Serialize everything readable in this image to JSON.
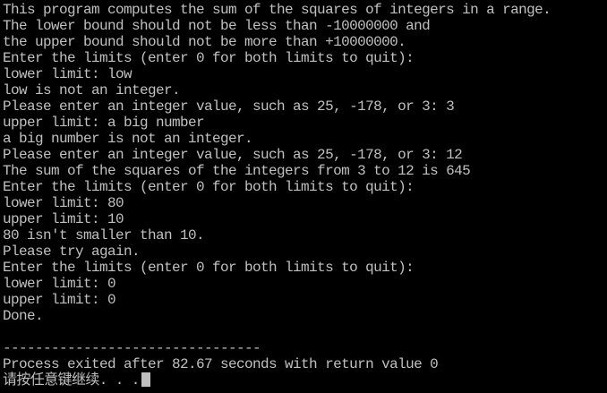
{
  "console": {
    "lines": [
      "This program computes the sum of the squares of integers in a range.",
      "The lower bound should not be less than -10000000 and",
      "the upper bound should not be more than +10000000.",
      "Enter the limits (enter 0 for both limits to quit):",
      "lower limit: low",
      "low is not an integer.",
      "Please enter an integer value, such as 25, -178, or 3: 3",
      "upper limit: a big number",
      "a big number is not an integer.",
      "Please enter an integer value, such as 25, -178, or 3: 12",
      "The sum of the squares of the integers from 3 to 12 is 645",
      "Enter the limits (enter 0 for both limits to quit):",
      "lower limit: 80",
      "upper limit: 10",
      "80 isn't smaller than 10.",
      "Please try again.",
      "Enter the limits (enter 0 for both limits to quit):",
      "lower limit: 0",
      "upper limit: 0",
      "Done.",
      "",
      "--------------------------------",
      "Process exited after 82.67 seconds with return value 0"
    ],
    "prompt": "请按任意键继续. . .",
    "text_color": "#c0c0c0",
    "background_color": "#000000"
  }
}
